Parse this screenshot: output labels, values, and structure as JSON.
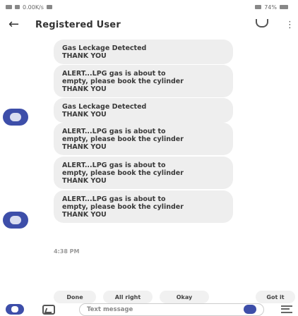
{
  "status_bar": {
    "left_text": "0.00K/s",
    "right_text": "74%"
  },
  "header": {
    "title": "Registered User",
    "back_icon": "arrow-left-icon",
    "call_icon": "phone-icon",
    "menu_icon": "more-vert-icon"
  },
  "messages": [
    {
      "text": "Gas Leckage Detected\nTHANK YOU"
    },
    {
      "text": "ALERT...LPG gas is about to\nempty, please book the cylinder\nTHANK YOU"
    },
    {
      "text": "Gas Leckage Detected\nTHANK YOU"
    },
    {
      "text": "ALERT...LPG gas is about to\nempty, please book the cylinder\nTHANK YOU"
    },
    {
      "text": "ALERT...LPG gas is about to\nempty, please book the cylinder\nTHANK YOU"
    },
    {
      "text": "ALERT...LPG gas is about to\nempty, please book the cylinder\nTHANK YOU"
    }
  ],
  "timestamp": "4:38 PM",
  "smart_replies": [
    "Done",
    "All right",
    "Okay",
    "Got it"
  ],
  "compose": {
    "placeholder": "Text message"
  },
  "colors": {
    "accent": "#3d4ea9",
    "bubble": "#eeeeee"
  }
}
